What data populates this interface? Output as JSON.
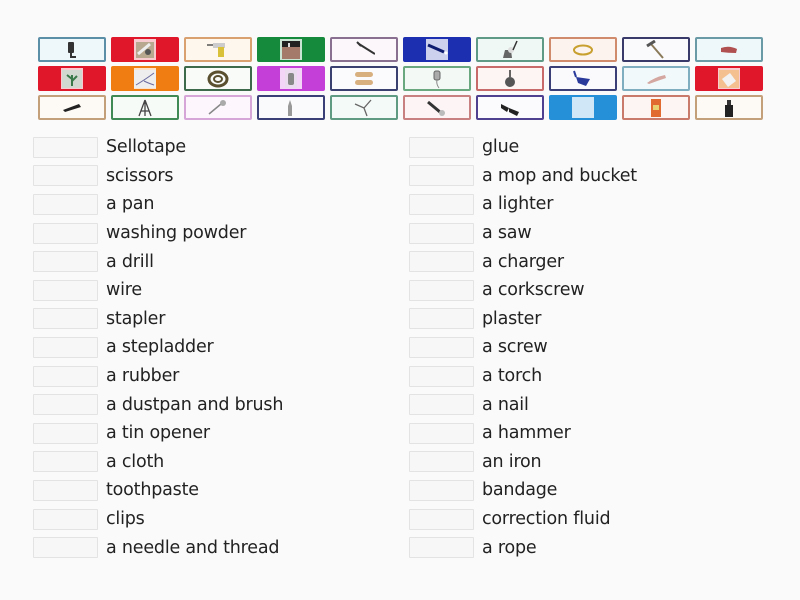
{
  "cards": [
    {
      "icon": "glue-icon",
      "border": "#5b8fa8",
      "bg": "#eef8fb"
    },
    {
      "icon": "sellotape-photo-icon",
      "border": "#e0162a",
      "bg": "#e0162a"
    },
    {
      "icon": "drill-icon",
      "border": "#d9a070",
      "bg": "#fdf7ee"
    },
    {
      "icon": "window-photo-icon",
      "border": "#168a3c",
      "bg": "#168a3c"
    },
    {
      "icon": "nail-icon",
      "border": "#8a7090",
      "bg": "#fbf7fb"
    },
    {
      "icon": "torch-icon",
      "border": "#1c2fb0",
      "bg": "#1c2fb0"
    },
    {
      "icon": "mop-and-bucket-icon",
      "border": "#5f9a86",
      "bg": "#f0f8f6"
    },
    {
      "icon": "rubber-band-icon",
      "border": "#d08a6c",
      "bg": "#fdf3ee"
    },
    {
      "icon": "hammer-icon",
      "border": "#3a3a6a",
      "bg": "#fafafd"
    },
    {
      "icon": "rubber-icon",
      "border": "#6a9aa6",
      "bg": "#eef7f9"
    },
    {
      "icon": "plant-photo-icon",
      "border": "#e0162a",
      "bg": "#e0162a"
    },
    {
      "icon": "wire-icon",
      "border": "#f07d12",
      "bg": "#f07d12"
    },
    {
      "icon": "rope-icon",
      "border": "#3d6a4a",
      "bg": "#f9fbf9"
    },
    {
      "icon": "lighter-photo-icon",
      "border": "#c43fd8",
      "bg": "#c43fd8"
    },
    {
      "icon": "plaster-icon",
      "border": "#3a4070",
      "bg": "#fbfbfd"
    },
    {
      "icon": "charger-icon",
      "border": "#6aa880",
      "bg": "#f3faf5"
    },
    {
      "icon": "pan-icon",
      "border": "#c96a6a",
      "bg": "#fdf4f4"
    },
    {
      "icon": "dustpan-icon",
      "border": "#3a3f78",
      "bg": "#fafafd"
    },
    {
      "icon": "cloth-icon",
      "border": "#7faec0",
      "bg": "#f2f9fb"
    },
    {
      "icon": "washing-powder-photo-icon",
      "border": "#e0162a",
      "bg": "#e0162a"
    },
    {
      "icon": "stapler-icon",
      "border": "#c4a07a",
      "bg": "#fdf9f4"
    },
    {
      "icon": "stepladder-icon",
      "border": "#3f8a55",
      "bg": "#f7fbf8"
    },
    {
      "icon": "tin-opener-icon",
      "border": "#d7a6d9",
      "bg": "#fdf7fd"
    },
    {
      "icon": "toothpaste-icon",
      "border": "#3a3f78",
      "bg": "#fafafd"
    },
    {
      "icon": "corkscrew-icon",
      "border": "#5f9a82",
      "bg": "#f4faf7"
    },
    {
      "icon": "needle-and-thread-icon",
      "border": "#c98080",
      "bg": "#fdf5f5"
    },
    {
      "icon": "clips-icon",
      "border": "#504090",
      "bg": "#fbfafd"
    },
    {
      "icon": "blank-blue-card-icon",
      "border": "#2590d8",
      "bg": "#2590d8"
    },
    {
      "icon": "bandage-box-icon",
      "border": "#c97a6a",
      "bg": "#fdf5f3"
    },
    {
      "icon": "correction-fluid-icon",
      "border": "#c4a07a",
      "bg": "#fdf9f4"
    }
  ],
  "left_words": [
    "Sellotape",
    "scissors",
    "a pan",
    "washing powder",
    "a drill",
    "wire",
    "stapler",
    "a stepladder",
    "a rubber",
    "a dustpan and brush",
    "a tin opener",
    "a cloth",
    "toothpaste",
    "clips",
    "a needle and thread"
  ],
  "right_words": [
    "glue",
    "a mop and bucket",
    "a lighter",
    "a saw",
    "a charger",
    "a corkscrew",
    "plaster",
    "a screw",
    "a torch",
    "a nail",
    "a hammer",
    "an iron",
    "bandage",
    "correction fluid",
    "a rope"
  ]
}
